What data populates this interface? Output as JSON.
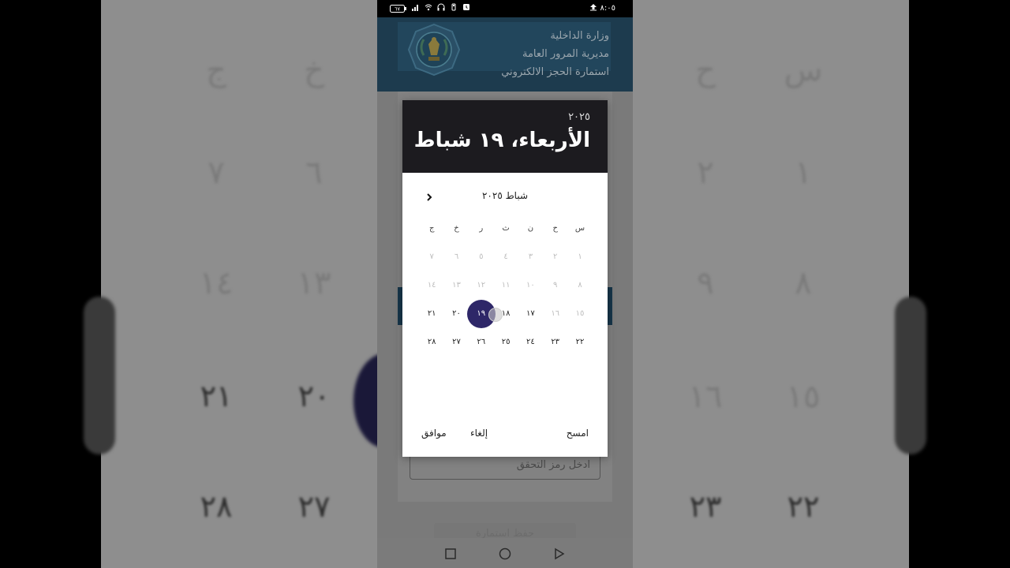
{
  "background": {
    "glyphs_row1": [
      "س",
      "ح",
      "خ",
      "ج"
    ],
    "glyphs_row2": [
      "١",
      "٢",
      "٦",
      "٧"
    ],
    "glyphs_row3": [
      "٨",
      "٩",
      "١٣",
      "١٤"
    ],
    "glyphs_row4": [
      "١٥",
      "١٦",
      "٢٠",
      "٢١"
    ],
    "glyphs_row5": [
      "٢٢",
      "٢٣",
      "٢٧",
      "٢٨"
    ]
  },
  "status_bar": {
    "time": "٨:٠٥",
    "battery": "٦٧"
  },
  "header": {
    "line1": "وزارة الداخلية",
    "line2": "مديرية المرور العامة",
    "line3": "استمارة الحجز الالكتروني"
  },
  "page": {
    "verify_placeholder": "ادخل رمز التحقق",
    "submit_label": "حفظ استمارة"
  },
  "date_picker": {
    "year": "٢٠٢٥",
    "selected_date_label": "الأربعاء، ١٩ شباط",
    "month_label": "شباط ٢٠٢٥",
    "weekdays": [
      "س",
      "ح",
      "ن",
      "ث",
      "ر",
      "خ",
      "ج"
    ],
    "weeks": [
      [
        {
          "d": "١",
          "dis": true
        },
        {
          "d": "٢",
          "dis": true
        },
        {
          "d": "٣",
          "dis": true
        },
        {
          "d": "٤",
          "dis": true
        },
        {
          "d": "٥",
          "dis": true
        },
        {
          "d": "٦",
          "dis": true
        },
        {
          "d": "٧",
          "dis": true
        }
      ],
      [
        {
          "d": "٨",
          "dis": true
        },
        {
          "d": "٩",
          "dis": true
        },
        {
          "d": "١٠",
          "dis": true
        },
        {
          "d": "١١",
          "dis": true
        },
        {
          "d": "١٢",
          "dis": true
        },
        {
          "d": "١٣",
          "dis": true
        },
        {
          "d": "١٤",
          "dis": true
        }
      ],
      [
        {
          "d": "١٥",
          "dis": true
        },
        {
          "d": "١٦",
          "dis": true
        },
        {
          "d": "١٧",
          "dis": false
        },
        {
          "d": "١٨",
          "dis": false
        },
        {
          "d": "١٩",
          "dis": false,
          "sel": true
        },
        {
          "d": "٢٠",
          "dis": false
        },
        {
          "d": "٢١",
          "dis": false
        }
      ],
      [
        {
          "d": "٢٢",
          "dis": false
        },
        {
          "d": "٢٣",
          "dis": false
        },
        {
          "d": "٢٤",
          "dis": false
        },
        {
          "d": "٢٥",
          "dis": false
        },
        {
          "d": "٢٦",
          "dis": false
        },
        {
          "d": "٢٧",
          "dis": false
        },
        {
          "d": "٢٨",
          "dis": false
        }
      ]
    ],
    "clear_label": "امسح",
    "cancel_label": "إلغاء",
    "ok_label": "موافق"
  },
  "colors": {
    "selected": "#2e2768",
    "header_dark": "#1c1b1f",
    "app_header": "#1d3b4e"
  }
}
